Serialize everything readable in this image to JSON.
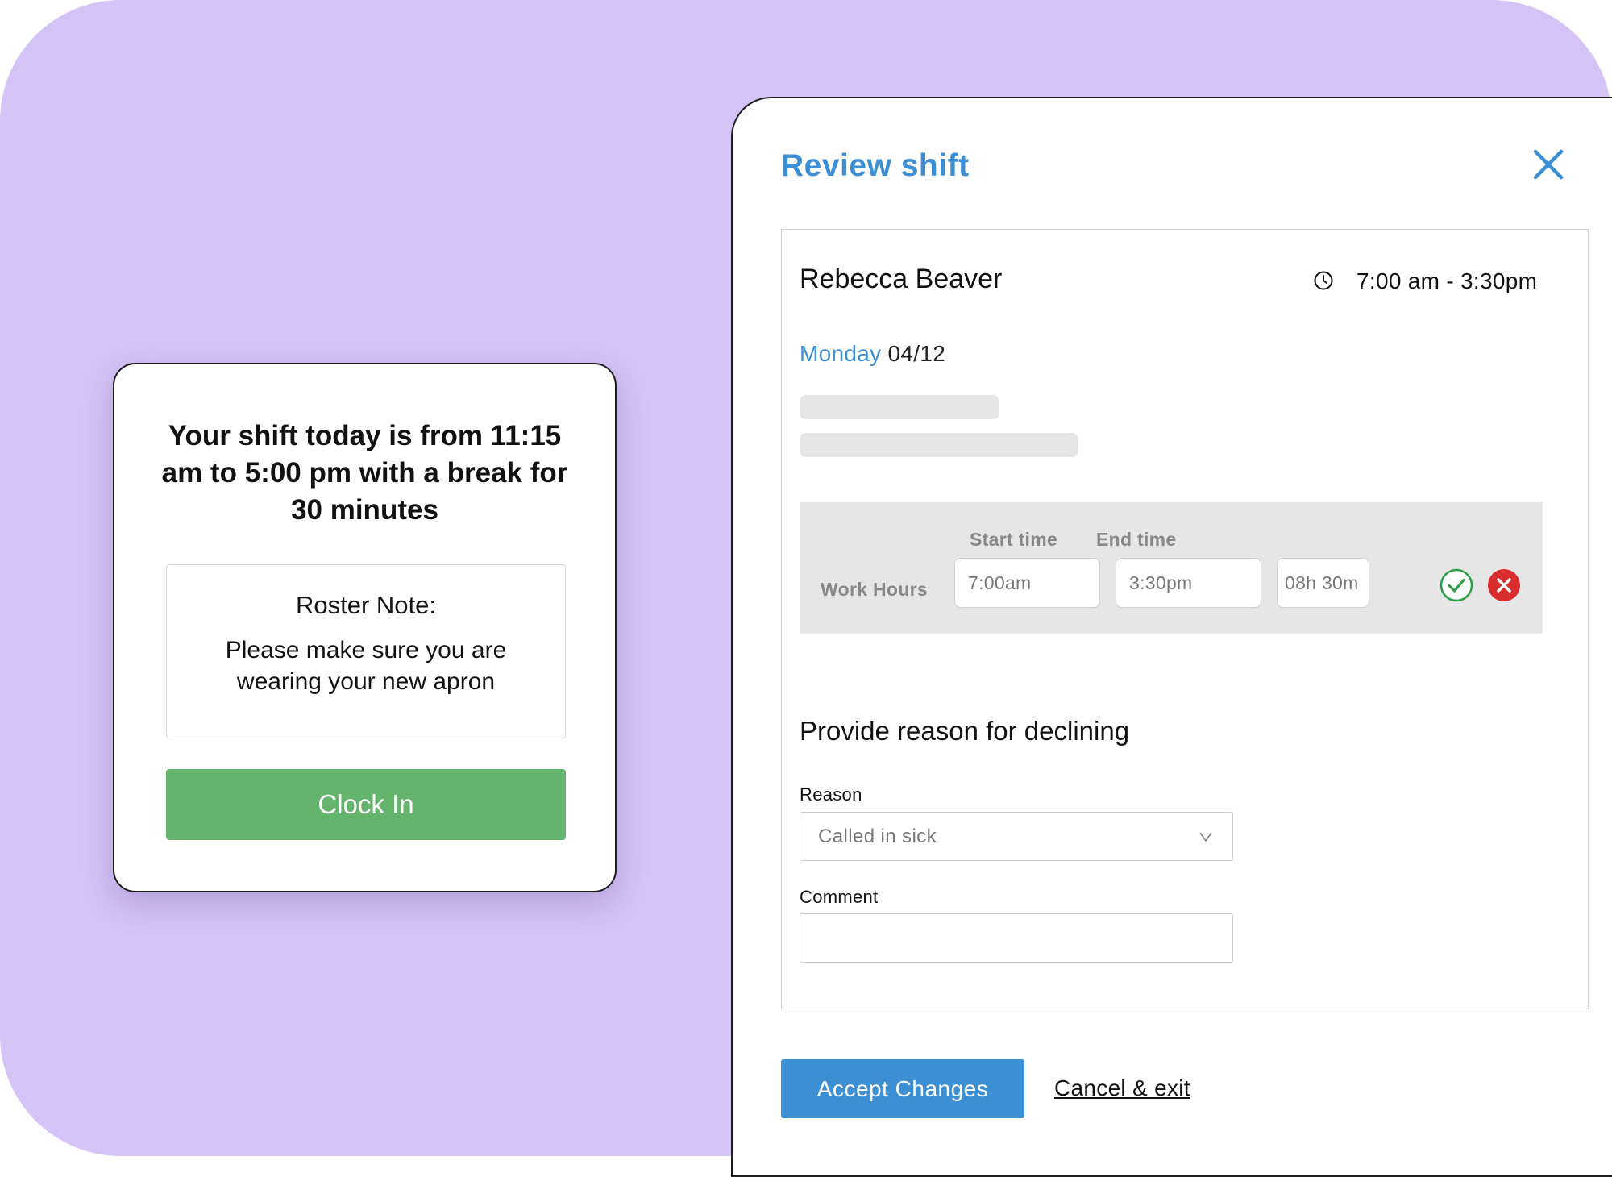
{
  "shift_card": {
    "message": "Your shift today is from 11:15 am to 5:00 pm with a break for 30 minutes",
    "note_title": "Roster Note:",
    "note_body": "Please make sure you are wearing your new apron",
    "clock_in_label": "Clock In",
    "clock_in_color": "#64b46d"
  },
  "review_panel": {
    "title": "Review shift",
    "close_icon": "close-icon",
    "employee_name": "Rebecca Beaver",
    "time_icon": "clock-icon",
    "shift_time": "7:00 am - 3:30pm",
    "day": "Monday",
    "date": "04/12",
    "work_hours": {
      "row_label": "Work Hours",
      "start_label": "Start time",
      "end_label": "End time",
      "start_value": "7:00am",
      "end_value": "3:30pm",
      "duration_value": "08h 30m",
      "approve_icon": "check-circle-icon",
      "reject_icon": "x-circle-icon"
    },
    "decline": {
      "title": "Provide reason for declining",
      "reason_label": "Reason",
      "reason_value": "Called in sick",
      "comment_label": "Comment",
      "comment_value": ""
    },
    "accept_label": "Accept Changes",
    "cancel_label": "Cancel & exit",
    "accent_color": "#3d8fd4"
  }
}
